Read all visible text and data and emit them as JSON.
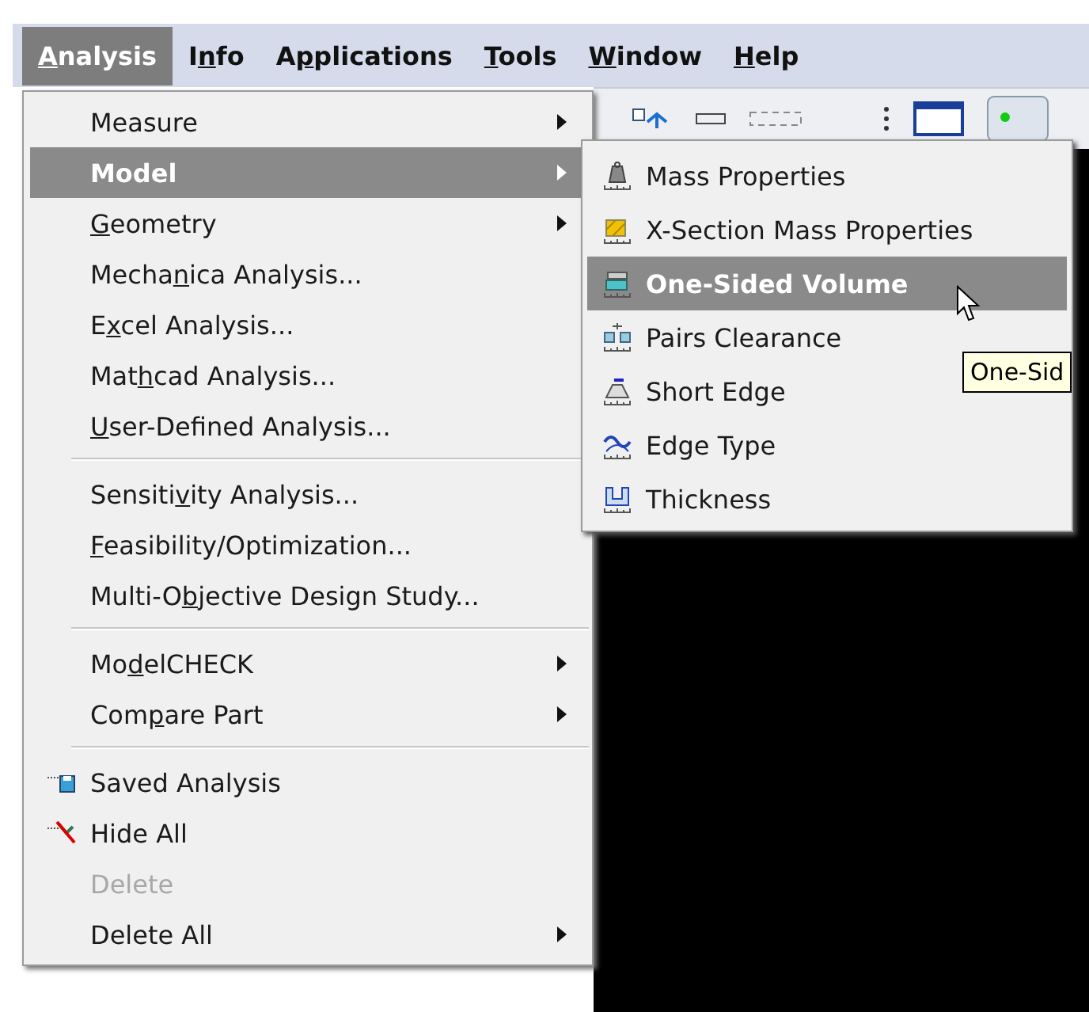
{
  "menubar": [
    {
      "key": "A",
      "post": "nalysis",
      "selected": true
    },
    {
      "pre": "I",
      "key": "n",
      "post": "fo",
      "selected": false
    },
    {
      "pre": "A",
      "key": "p",
      "post": "plications",
      "selected": false
    },
    {
      "key": "T",
      "post": "ools",
      "selected": false
    },
    {
      "key": "W",
      "post": "indow",
      "selected": false
    },
    {
      "key": "H",
      "post": "elp",
      "selected": false
    }
  ],
  "menu": [
    {
      "kind": "item",
      "pre": "Measure",
      "submenu": true,
      "selected": false,
      "disabled": false
    },
    {
      "kind": "item",
      "pre": "Model",
      "submenu": true,
      "selected": true,
      "disabled": false
    },
    {
      "kind": "item",
      "key": "G",
      "post": "eometry",
      "submenu": true,
      "selected": false,
      "disabled": false
    },
    {
      "kind": "item",
      "pre": "Mecha",
      "key": "n",
      "post": "ica Analysis...",
      "submenu": false,
      "selected": false,
      "disabled": false
    },
    {
      "kind": "item",
      "pre": "E",
      "key": "x",
      "post": "cel Analysis...",
      "submenu": false,
      "selected": false,
      "disabled": false
    },
    {
      "kind": "item",
      "pre": "Mat",
      "key": "h",
      "post": "cad Analysis...",
      "submenu": false,
      "selected": false,
      "disabled": false
    },
    {
      "kind": "item",
      "key": "U",
      "post": "ser-Defined Analysis...",
      "submenu": false,
      "selected": false,
      "disabled": false
    },
    {
      "kind": "separator"
    },
    {
      "kind": "item",
      "pre": "Sensiti",
      "key": "v",
      "post": "ity Analysis...",
      "submenu": false,
      "selected": false,
      "disabled": false
    },
    {
      "kind": "item",
      "key": "F",
      "post": "easibility/Optimization...",
      "submenu": false,
      "selected": false,
      "disabled": false
    },
    {
      "kind": "item",
      "pre": "Multi-O",
      "key": "b",
      "post": "jective Design Study...",
      "submenu": false,
      "selected": false,
      "disabled": false
    },
    {
      "kind": "separator"
    },
    {
      "kind": "item",
      "pre": "Mo",
      "key": "d",
      "post": "elCHECK",
      "submenu": true,
      "selected": false,
      "disabled": false
    },
    {
      "kind": "item",
      "pre": "Com",
      "key": "p",
      "post": "are Part",
      "submenu": true,
      "selected": false,
      "disabled": false
    },
    {
      "kind": "separator"
    },
    {
      "kind": "icon-item",
      "pre": "Saved Analysis",
      "submenu": false,
      "selected": false,
      "disabled": false
    },
    {
      "kind": "icon-item",
      "pre": "Hide All",
      "submenu": false,
      "selected": false,
      "disabled": false
    },
    {
      "kind": "item",
      "pre": "Delete",
      "submenu": false,
      "selected": false,
      "disabled": true
    },
    {
      "kind": "item",
      "pre": "Delete All",
      "submenu": true,
      "selected": false,
      "disabled": false
    }
  ],
  "submenu": [
    {
      "label": "Mass Properties",
      "selected": false
    },
    {
      "label": "X-Section Mass Properties",
      "selected": false
    },
    {
      "label": "One-Sided Volume",
      "selected": true
    },
    {
      "label": "Pairs Clearance",
      "selected": false
    },
    {
      "label": "Short Edge",
      "selected": false
    },
    {
      "label": "Edge Type",
      "selected": false
    },
    {
      "label": "Thickness",
      "selected": false
    }
  ],
  "tooltip": "One-Sid"
}
